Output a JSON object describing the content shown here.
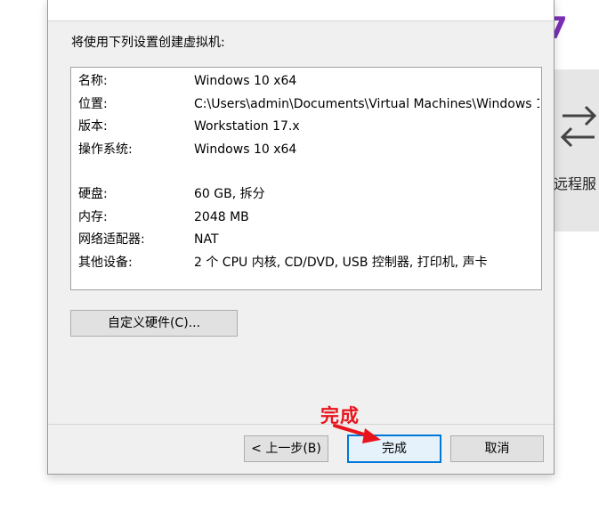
{
  "background": {
    "accent_char": "7",
    "swap_icon": "swap-arrows-icon",
    "remote_label": "远程服"
  },
  "dialog": {
    "intro": "将使用下列设置创建虚拟机:",
    "summary": [
      {
        "key": "名称:",
        "value": "Windows 10 x64"
      },
      {
        "key": "位置:",
        "value": "C:\\Users\\admin\\Documents\\Virtual Machines\\Windows 1..."
      },
      {
        "key": "版本:",
        "value": "Workstation 17.x"
      },
      {
        "key": "操作系统:",
        "value": "Windows 10 x64"
      },
      {
        "key": "硬盘:",
        "value": "60 GB, 拆分"
      },
      {
        "key": "内存:",
        "value": "2048 MB"
      },
      {
        "key": "网络适配器:",
        "value": "NAT"
      },
      {
        "key": "其他设备:",
        "value": "2 个 CPU 内核, CD/DVD, USB 控制器, 打印机, 声卡"
      }
    ],
    "customize_button": "自定义硬件(C)...",
    "back_button": "< 上一步(B)",
    "finish_button": "完成",
    "cancel_button": "取消"
  },
  "annotation": {
    "label": "完成",
    "color": "#e8141c",
    "arrow_icon": "red-arrow-icon"
  },
  "colors": {
    "accent": "#7b2fb5",
    "focus_border": "#0078d7"
  }
}
